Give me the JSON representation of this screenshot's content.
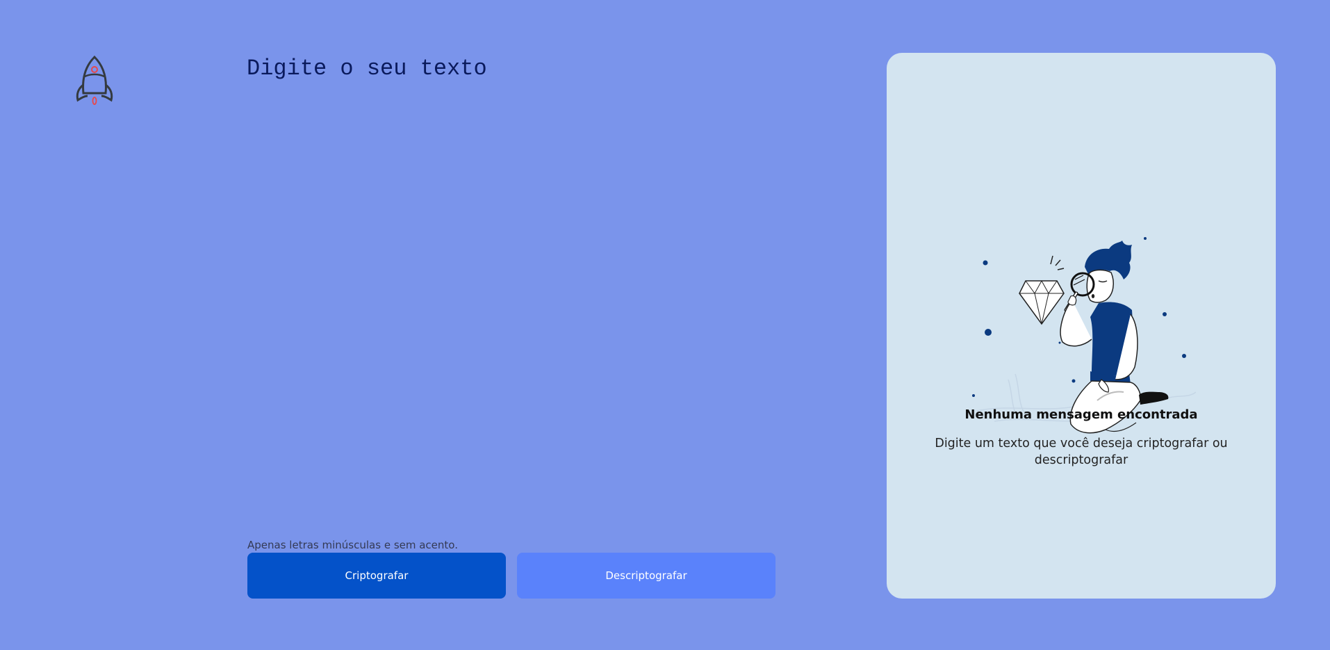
{
  "logo": {
    "icon": "rocket-icon",
    "color": "#343a40",
    "accent": "#e8484a"
  },
  "input": {
    "placeholder": "Digite o seu texto",
    "value": ""
  },
  "hint": {
    "text": "Apenas letras minúsculas e sem acento."
  },
  "buttons": {
    "encrypt_label": "Criptografar",
    "decrypt_label": "Descriptografar"
  },
  "output_panel": {
    "illustration": "person-with-magnifier-and-diamond-illustration",
    "title": "Nenhuma mensagem encontrada",
    "description": "Digite um texto que você deseja criptografar ou descriptografar"
  },
  "colors": {
    "background": "#7a94eb",
    "primary_button": "#0452c9",
    "secondary_button": "#5a82fb",
    "panel": "#d3e4f0"
  }
}
